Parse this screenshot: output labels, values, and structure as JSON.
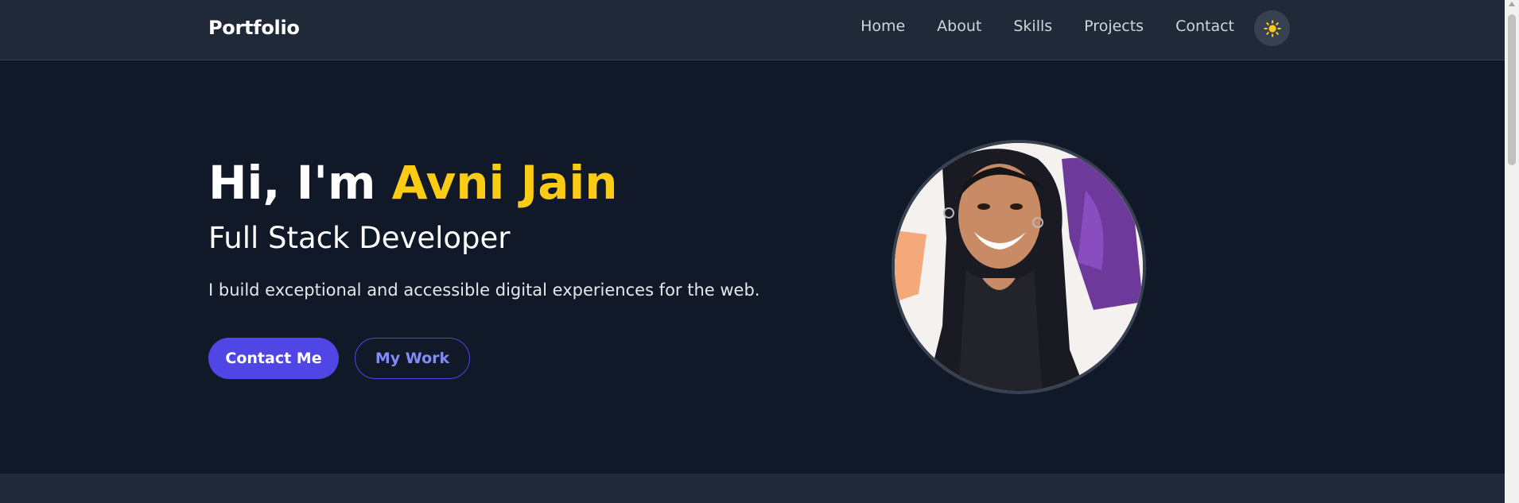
{
  "navbar": {
    "brand": "Portfolio",
    "links": [
      "Home",
      "About",
      "Skills",
      "Projects",
      "Contact"
    ],
    "theme_icon": "sun-icon"
  },
  "hero": {
    "greeting": "Hi, I'm ",
    "name": "Avni Jain",
    "role": "Full Stack Developer",
    "description": "I build exceptional and accessible digital experiences for the web.",
    "primary_button": "Contact Me",
    "secondary_button": "My Work",
    "avatar_icon": "profile-photo"
  },
  "colors": {
    "nav_bg": "#1f2937",
    "page_bg": "#111827",
    "accent": "#4f46e5",
    "name_highlight": "#facc15",
    "outline_text": "#818cf8"
  }
}
